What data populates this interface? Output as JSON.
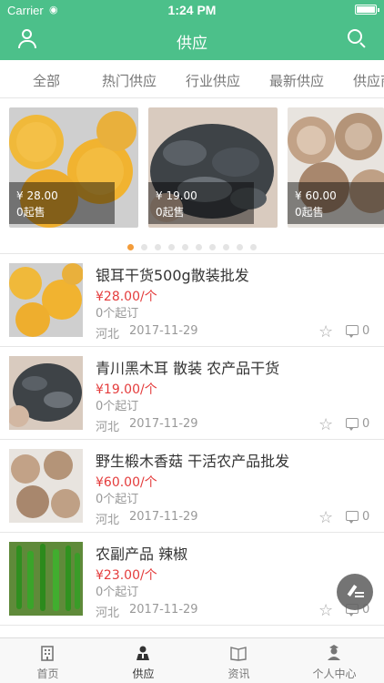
{
  "status_bar": {
    "carrier": "Carrier",
    "time": "1:24 PM"
  },
  "nav": {
    "title": "供应"
  },
  "tabs": [
    {
      "label": "全部"
    },
    {
      "label": "热门供应"
    },
    {
      "label": "行业供应"
    },
    {
      "label": "最新供应"
    },
    {
      "label": "供应商"
    }
  ],
  "carousel": {
    "slides": [
      {
        "price": "¥ 28.00",
        "moq": "0起售",
        "image": "yellow-fungus"
      },
      {
        "price": "¥ 19.00",
        "moq": "0起售",
        "image": "black-fungus"
      },
      {
        "price": "¥ 60.00",
        "moq": "0起售",
        "image": "shiitake"
      }
    ],
    "dots_total": 10,
    "active_index": 0
  },
  "items": [
    {
      "title": "银耳干货500g散装批发",
      "price": "¥28.00/个",
      "moq": "0个起订",
      "region": "河北",
      "date": "2017-11-29",
      "comments": "0",
      "image": "yellow-fungus"
    },
    {
      "title": "青川黑木耳 散装 农产品干货",
      "price": "¥19.00/个",
      "moq": "0个起订",
      "region": "河北",
      "date": "2017-11-29",
      "comments": "0",
      "image": "black-fungus"
    },
    {
      "title": "野生椴木香菇 干活农产品批发",
      "price": "¥60.00/个",
      "moq": "0个起订",
      "region": "河北",
      "date": "2017-11-29",
      "comments": "0",
      "image": "shiitake"
    },
    {
      "title": "农副产品 辣椒",
      "price": "¥23.00/个",
      "moq": "0个起订",
      "region": "河北",
      "date": "2017-11-29",
      "comments": "0",
      "image": "green-peppers"
    }
  ],
  "tabbar": [
    {
      "label": "首页",
      "icon": "building-icon"
    },
    {
      "label": "供应",
      "icon": "person-icon"
    },
    {
      "label": "资讯",
      "icon": "book-icon"
    },
    {
      "label": "个人中心",
      "icon": "user-hat-icon"
    }
  ],
  "colors": {
    "brand": "#4cc08a",
    "price": "#e43c3c",
    "active_dot": "#f39c3a"
  }
}
